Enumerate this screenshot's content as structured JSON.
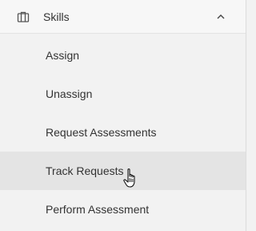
{
  "menu": {
    "section_label": "Skills",
    "section_icon": "briefcase-icon",
    "expanded_icon": "chevron-up-icon",
    "items": [
      {
        "label": "Assign"
      },
      {
        "label": "Unassign"
      },
      {
        "label": "Request Assessments"
      },
      {
        "label": "Track Requests",
        "hovered": true
      },
      {
        "label": "Perform Assessment"
      }
    ]
  },
  "colors": {
    "background": "#f2f2f2",
    "hover_background": "#e4e4e4",
    "text": "#333333"
  },
  "cursor_icon": "hand-pointer-icon"
}
